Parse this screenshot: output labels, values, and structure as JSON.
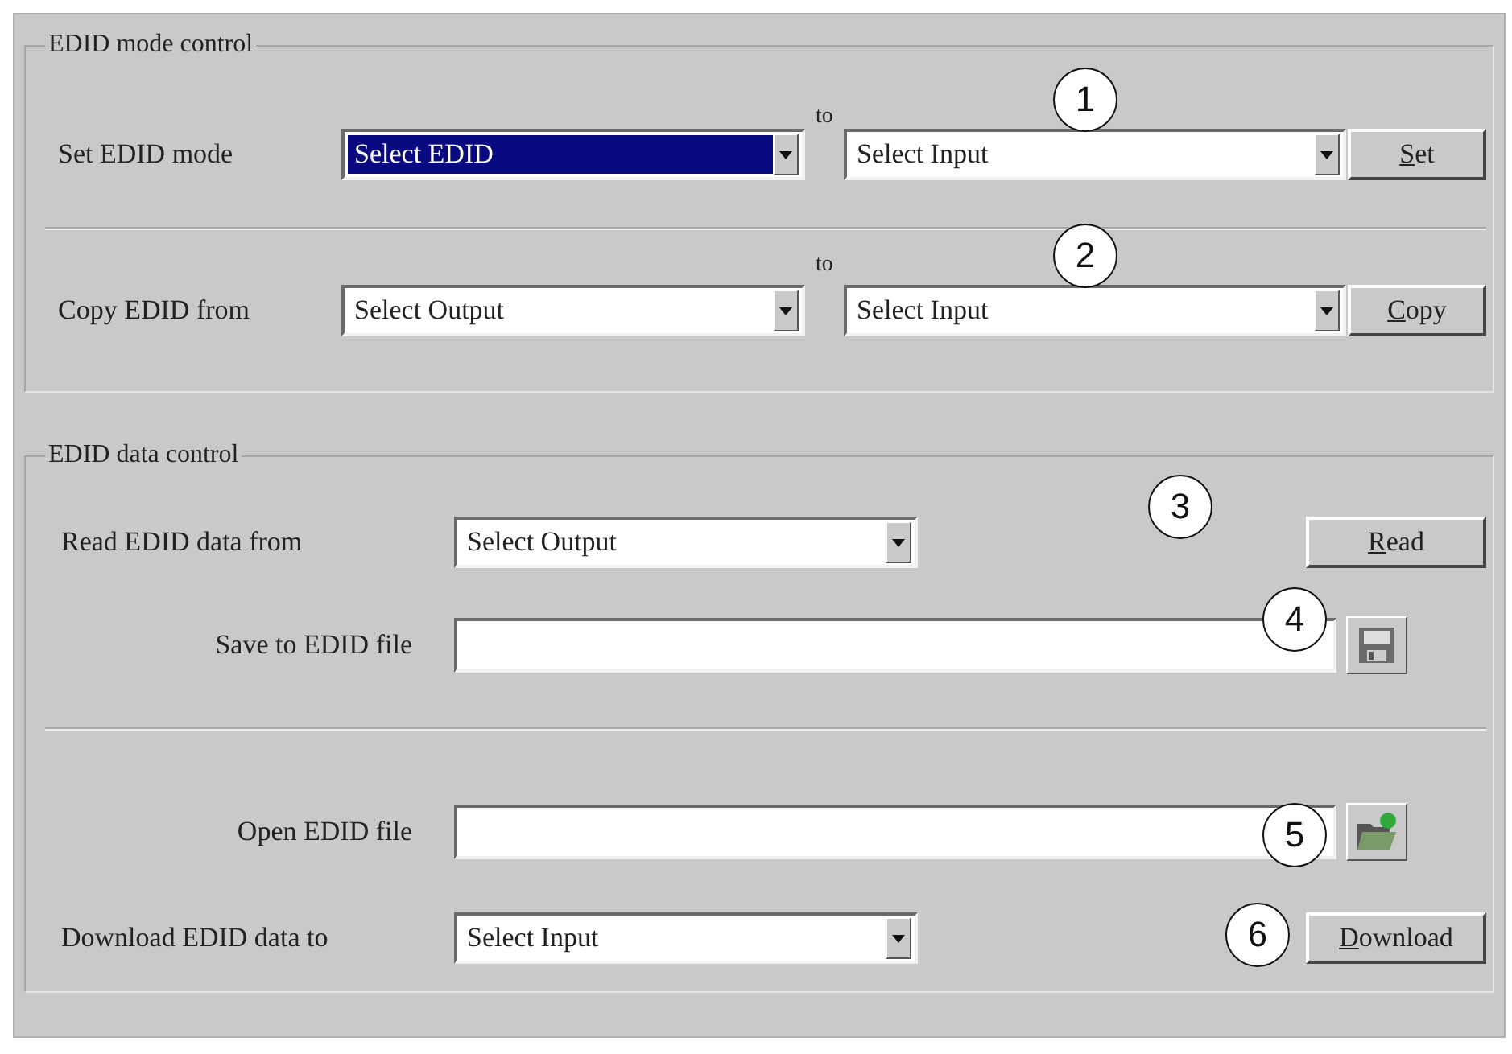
{
  "mode_control": {
    "title": "EDID mode control",
    "rows": [
      {
        "label": "Set EDID mode",
        "source": {
          "value": "Select EDID",
          "selected": true
        },
        "joiner": "to",
        "target": {
          "value": "Select Input",
          "selected": false
        },
        "button": {
          "label": "Set"
        },
        "callout": "1"
      },
      {
        "label": "Copy EDID from",
        "source": {
          "value": "Select Output",
          "selected": false
        },
        "joiner": "to",
        "target": {
          "value": "Select Input",
          "selected": false
        },
        "button": {
          "label": "Copy"
        },
        "callout": "2"
      }
    ]
  },
  "data_control": {
    "title": "EDID data control",
    "rows": [
      {
        "kind": "dropdown",
        "label": "Read EDID data from",
        "value": "Select Output",
        "button": {
          "label": "Read"
        },
        "callout": "3"
      },
      {
        "kind": "save_file",
        "label": "Save to EDID file",
        "callout": "4"
      },
      {
        "kind": "divider"
      },
      {
        "kind": "open_file",
        "label": "Open EDID file",
        "callout": "5"
      },
      {
        "kind": "dropdown",
        "label": "Download EDID data to",
        "value": "Select Input",
        "button": {
          "label": "Download"
        },
        "callout": "6"
      }
    ]
  }
}
